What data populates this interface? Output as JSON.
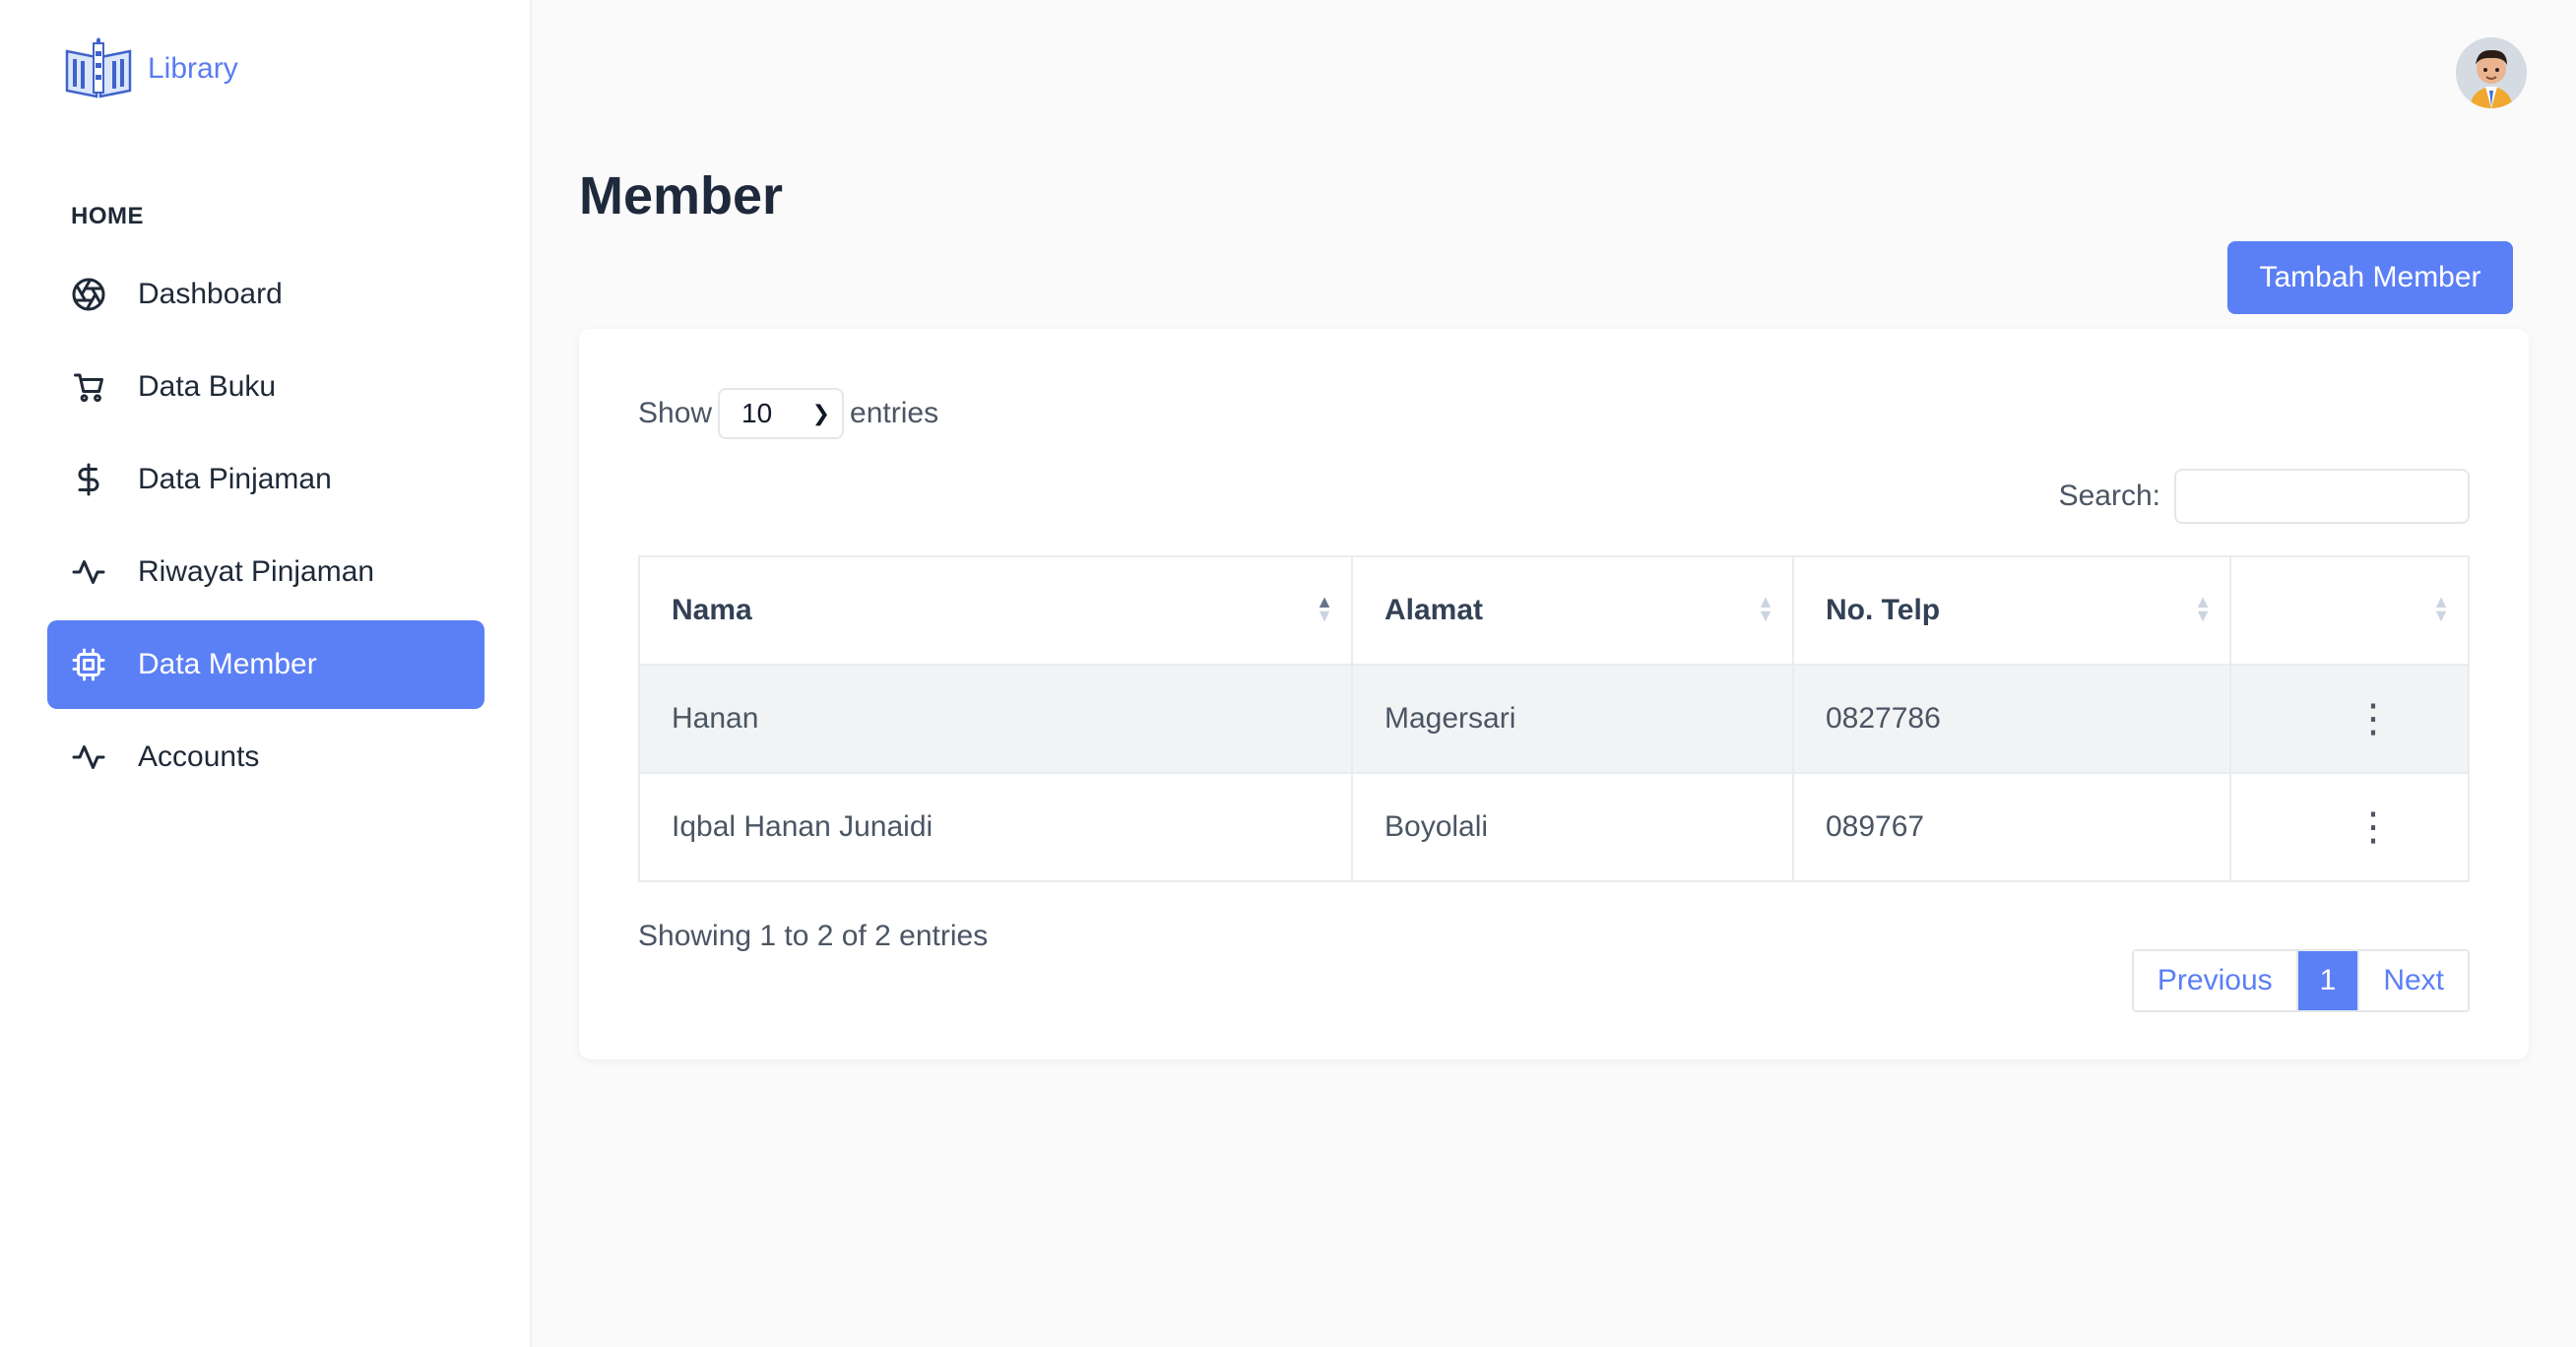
{
  "brand": {
    "name": "Library",
    "logo_icon": "library-book-logo-icon"
  },
  "sidebar": {
    "heading": "HOME",
    "items": [
      {
        "label": "Dashboard",
        "icon": "aperture-icon",
        "active": false
      },
      {
        "label": "Data Buku",
        "icon": "cart-icon",
        "active": false
      },
      {
        "label": "Data Pinjaman",
        "icon": "dollar-icon",
        "active": false
      },
      {
        "label": "Riwayat Pinjaman",
        "icon": "activity-icon",
        "active": false
      },
      {
        "label": "Data Member",
        "icon": "chip-icon",
        "active": true
      },
      {
        "label": "Accounts",
        "icon": "activity-icon",
        "active": false
      }
    ]
  },
  "header": {
    "avatar_icon": "user-avatar"
  },
  "page": {
    "title": "Member",
    "add_button": "Tambah Member"
  },
  "table_controls": {
    "show_label": "Show",
    "entries_label": "entries",
    "page_size": "10",
    "search_label": "Search:",
    "search_value": ""
  },
  "table": {
    "columns": [
      "Nama",
      "Alamat",
      "No. Telp",
      ""
    ],
    "rows": [
      {
        "nama": "Hanan",
        "alamat": "Magersari",
        "telp": "0827786",
        "action": "⋮"
      },
      {
        "nama": "Iqbal Hanan Junaidi",
        "alamat": "Boyolali",
        "telp": "089767",
        "action": "⋮"
      }
    ]
  },
  "footer": {
    "info": "Showing 1 to 2 of 2 entries",
    "prev": "Previous",
    "current_page": "1",
    "next": "Next"
  },
  "colors": {
    "accent": "#5b7ff5",
    "brand_text": "#5b7cf0",
    "row_stripe": "#f2f3f5"
  }
}
